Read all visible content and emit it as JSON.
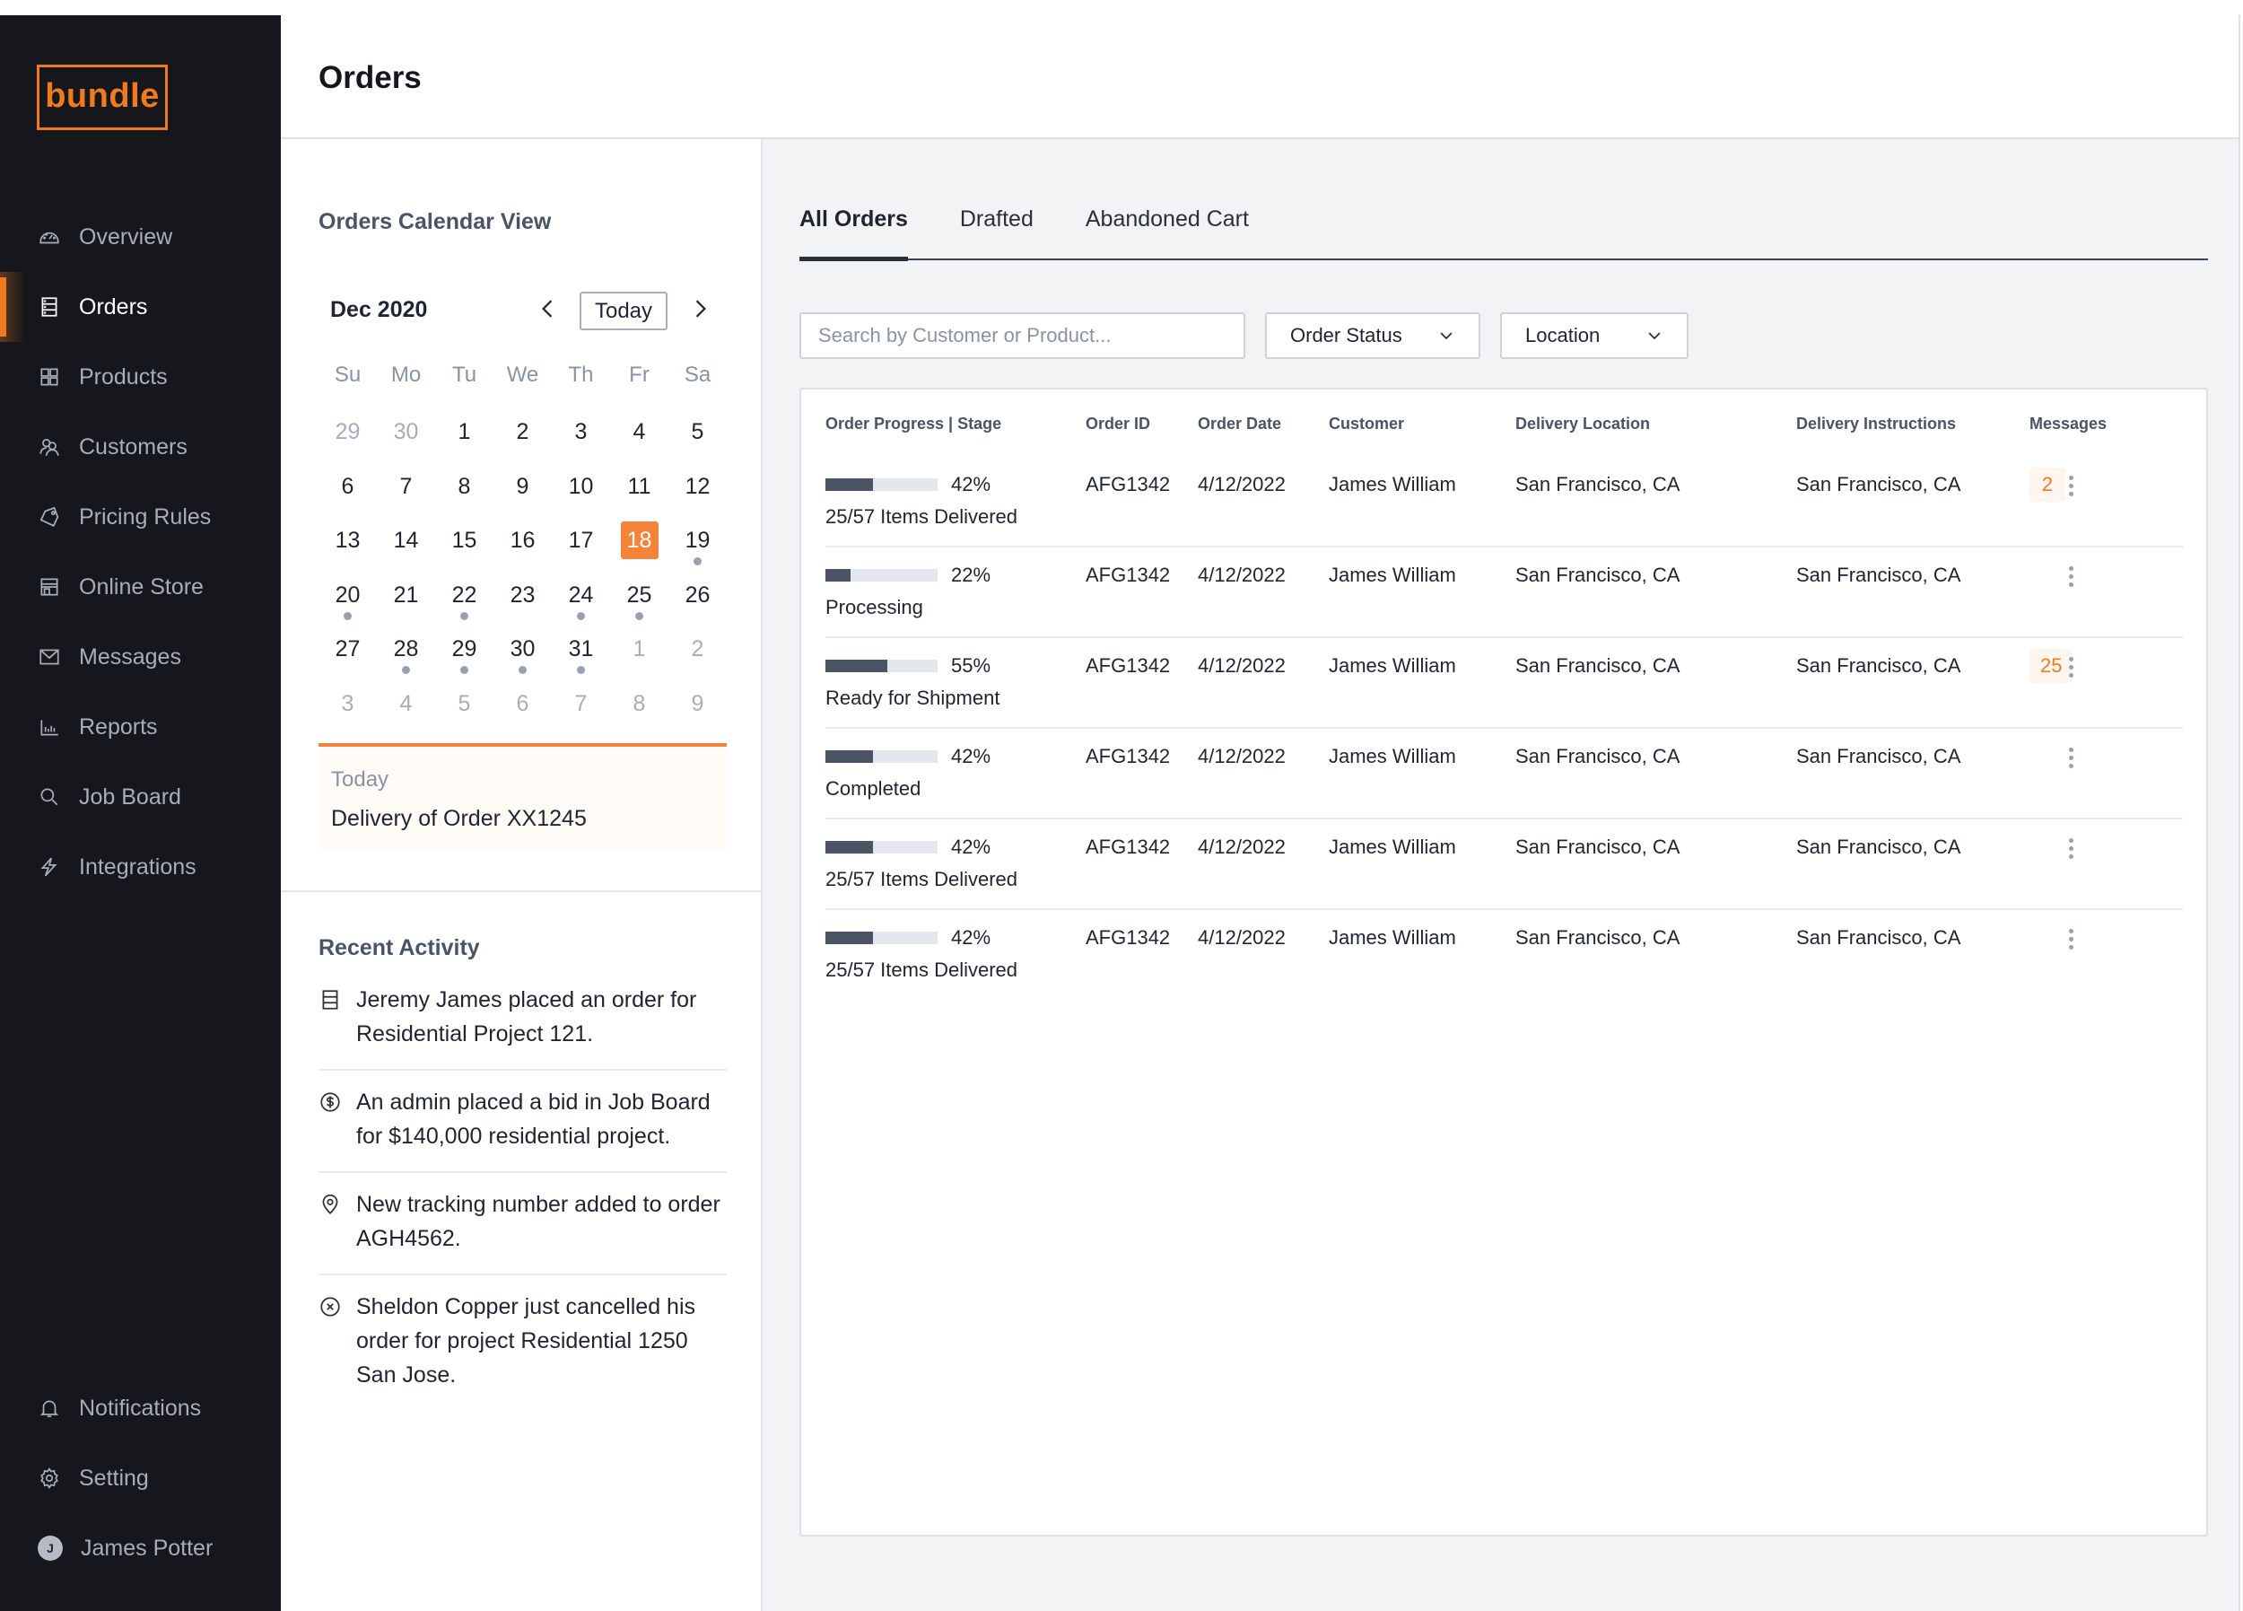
{
  "app": {
    "logo": "bundle",
    "accent_color": "#f07a1e"
  },
  "sidebar": {
    "items": [
      {
        "label": "Overview",
        "icon": "gauge-icon",
        "active": false
      },
      {
        "label": "Orders",
        "icon": "orders-icon",
        "active": true
      },
      {
        "label": "Products",
        "icon": "grid-icon",
        "active": false
      },
      {
        "label": "Customers",
        "icon": "users-icon",
        "active": false
      },
      {
        "label": "Pricing Rules",
        "icon": "tag-icon",
        "active": false
      },
      {
        "label": "Online Store",
        "icon": "store-icon",
        "active": false
      },
      {
        "label": "Messages",
        "icon": "mail-icon",
        "active": false
      },
      {
        "label": "Reports",
        "icon": "bar-chart-icon",
        "active": false
      },
      {
        "label": "Job Board",
        "icon": "search-icon",
        "active": false
      },
      {
        "label": "Integrations",
        "icon": "lightning-icon",
        "active": false
      }
    ],
    "bottom": {
      "notifications": "Notifications",
      "setting": "Setting",
      "user_name": "James Potter",
      "user_initial": "J"
    }
  },
  "header": {
    "title": "Orders"
  },
  "calendar": {
    "title": "Orders Calendar View",
    "month_label": "Dec 2020",
    "today_button": "Today",
    "weekdays": [
      "Su",
      "Mo",
      "Tu",
      "We",
      "Th",
      "Fr",
      "Sa"
    ],
    "weeks": [
      [
        {
          "d": "29",
          "muted": true
        },
        {
          "d": "30",
          "muted": true
        },
        {
          "d": "1"
        },
        {
          "d": "2"
        },
        {
          "d": "3"
        },
        {
          "d": "4"
        },
        {
          "d": "5"
        }
      ],
      [
        {
          "d": "6"
        },
        {
          "d": "7"
        },
        {
          "d": "8"
        },
        {
          "d": "9"
        },
        {
          "d": "10"
        },
        {
          "d": "11"
        },
        {
          "d": "12"
        }
      ],
      [
        {
          "d": "13"
        },
        {
          "d": "14"
        },
        {
          "d": "15"
        },
        {
          "d": "16"
        },
        {
          "d": "17"
        },
        {
          "d": "18",
          "today": true
        },
        {
          "d": "19",
          "event": true
        }
      ],
      [
        {
          "d": "20",
          "event": true
        },
        {
          "d": "21"
        },
        {
          "d": "22",
          "event": true
        },
        {
          "d": "23"
        },
        {
          "d": "24",
          "event": true
        },
        {
          "d": "25",
          "event": true
        },
        {
          "d": "26"
        }
      ],
      [
        {
          "d": "27"
        },
        {
          "d": "28",
          "event": true
        },
        {
          "d": "29",
          "event": true
        },
        {
          "d": "30",
          "event": true
        },
        {
          "d": "31",
          "event": true
        },
        {
          "d": "1",
          "muted": true
        },
        {
          "d": "2",
          "muted": true
        }
      ],
      [
        {
          "d": "3",
          "muted": true
        },
        {
          "d": "4",
          "muted": true
        },
        {
          "d": "5",
          "muted": true
        },
        {
          "d": "6",
          "muted": true
        },
        {
          "d": "7",
          "muted": true
        },
        {
          "d": "8",
          "muted": true
        },
        {
          "d": "9",
          "muted": true
        }
      ]
    ],
    "today_box": {
      "label": "Today",
      "event": "Delivery of Order XX1245"
    }
  },
  "recent_activity": {
    "title": "Recent Activity",
    "items": [
      {
        "icon": "orders-icon",
        "text": "Jeremy James placed an order for Residential Project 121."
      },
      {
        "icon": "dollar-icon",
        "text": "An admin placed a bid in Job Board for $140,000 residential project."
      },
      {
        "icon": "location-pin-icon",
        "text": "New tracking number added to order AGH4562."
      },
      {
        "icon": "cancel-circle-icon",
        "text": "Sheldon Copper just cancelled his order for project Residential 1250 San Jose."
      }
    ]
  },
  "main": {
    "tabs": [
      {
        "label": "All Orders",
        "active": true
      },
      {
        "label": "Drafted",
        "active": false
      },
      {
        "label": "Abandoned Cart",
        "active": false
      }
    ],
    "search": {
      "placeholder": "Search by Customer or Product...",
      "value": ""
    },
    "filters": {
      "order_status": "Order Status",
      "location": "Location"
    },
    "table": {
      "columns": [
        "Order Progress | Stage",
        "Order ID",
        "Order Date",
        "Customer",
        "Delivery Location",
        "Delivery Instructions",
        "Messages"
      ],
      "rows": [
        {
          "progress_pct": 42,
          "progress_label": "42%",
          "stage": "25/57 Items Delivered",
          "order_id": "AFG1342",
          "order_date": "4/12/2022",
          "customer": "James William",
          "delivery_location": "San Francisco, CA",
          "delivery_instructions": "San Francisco, CA",
          "messages": "2"
        },
        {
          "progress_pct": 22,
          "progress_label": "22%",
          "stage": "Processing",
          "order_id": "AFG1342",
          "order_date": "4/12/2022",
          "customer": "James William",
          "delivery_location": "San Francisco, CA",
          "delivery_instructions": "San Francisco, CA",
          "messages": ""
        },
        {
          "progress_pct": 55,
          "progress_label": "55%",
          "stage": "Ready for Shipment",
          "order_id": "AFG1342",
          "order_date": "4/12/2022",
          "customer": "James William",
          "delivery_location": "San Francisco, CA",
          "delivery_instructions": "San Francisco, CA",
          "messages": "25"
        },
        {
          "progress_pct": 42,
          "progress_label": "42%",
          "stage": "Completed",
          "order_id": "AFG1342",
          "order_date": "4/12/2022",
          "customer": "James William",
          "delivery_location": "San Francisco, CA",
          "delivery_instructions": "San Francisco, CA",
          "messages": ""
        },
        {
          "progress_pct": 42,
          "progress_label": "42%",
          "stage": "25/57 Items Delivered",
          "order_id": "AFG1342",
          "order_date": "4/12/2022",
          "customer": "James William",
          "delivery_location": "San Francisco, CA",
          "delivery_instructions": "San Francisco, CA",
          "messages": ""
        },
        {
          "progress_pct": 42,
          "progress_label": "42%",
          "stage": "25/57 Items Delivered",
          "order_id": "AFG1342",
          "order_date": "4/12/2022",
          "customer": "James William",
          "delivery_location": "San Francisco, CA",
          "delivery_instructions": "San Francisco, CA",
          "messages": ""
        }
      ]
    }
  }
}
